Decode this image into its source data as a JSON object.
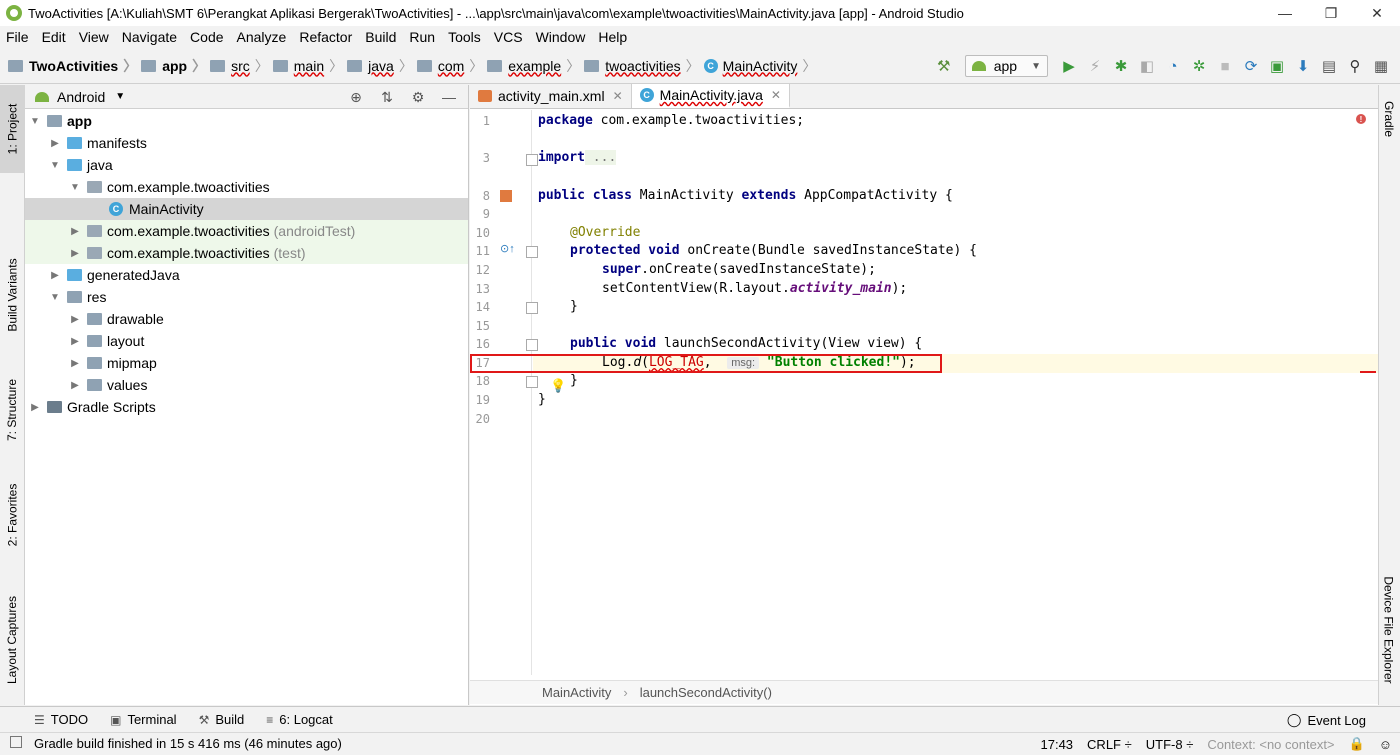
{
  "window": {
    "title": "TwoActivities [A:\\Kuliah\\SMT 6\\Perangkat Aplikasi Bergerak\\TwoActivities] - ...\\app\\src\\main\\java\\com\\example\\twoactivities\\MainActivity.java [app] - Android Studio",
    "minimize": "—",
    "maximize": "❐",
    "close": "✕"
  },
  "menu": [
    "File",
    "Edit",
    "View",
    "Navigate",
    "Code",
    "Analyze",
    "Refactor",
    "Build",
    "Run",
    "Tools",
    "VCS",
    "Window",
    "Help"
  ],
  "nav": {
    "crumbs": [
      "TwoActivities",
      "app",
      "src",
      "main",
      "java",
      "com",
      "example",
      "twoactivities",
      "MainActivity"
    ],
    "run_config": "app"
  },
  "left_tabs": [
    "1: Project",
    "Build Variants",
    "7: Structure",
    "2: Favorites",
    "Layout Captures"
  ],
  "right_tabs": [
    "Gradle",
    "Device File Explorer"
  ],
  "project": {
    "view": "Android",
    "tree": [
      {
        "label": "app",
        "suffix": ""
      },
      {
        "label": "manifests",
        "suffix": ""
      },
      {
        "label": "java",
        "suffix": ""
      },
      {
        "label": "com.example.twoactivities",
        "suffix": ""
      },
      {
        "label": "MainActivity",
        "suffix": ""
      },
      {
        "label": "com.example.twoactivities",
        "suffix": "(androidTest)"
      },
      {
        "label": "com.example.twoactivities",
        "suffix": "(test)"
      },
      {
        "label": "generatedJava",
        "suffix": ""
      },
      {
        "label": "res",
        "suffix": ""
      },
      {
        "label": "drawable",
        "suffix": ""
      },
      {
        "label": "layout",
        "suffix": ""
      },
      {
        "label": "mipmap",
        "suffix": ""
      },
      {
        "label": "values",
        "suffix": ""
      },
      {
        "label": "Gradle Scripts",
        "suffix": ""
      }
    ]
  },
  "editor": {
    "tabs": [
      "activity_main.xml",
      "MainActivity.java"
    ],
    "line_numbers": [
      "1",
      "3",
      "8",
      "9",
      "10",
      "11",
      "12",
      "13",
      "14",
      "15",
      "16",
      "17",
      "18",
      "19",
      "20"
    ],
    "code": {
      "l1_kw": "package",
      "l1_rest": " com.example.twoactivities;",
      "l3_kw": "import",
      "l3_fold": " ...",
      "l8_kw1": "public class",
      "l8_mid": " MainActivity ",
      "l8_kw2": "extends",
      "l8_rest": " AppCompatActivity {",
      "l10_ann": "@Override",
      "l11_kw": "protected void",
      "l11_rest": " onCreate(Bundle savedInstanceState) {",
      "l12_kw": "super",
      "l12_rest": ".onCreate(savedInstanceState);",
      "l13_pre": "setContentView(R.layout.",
      "l13_field": "activity_main",
      "l13_post": ");",
      "l14": "}",
      "l16_kw": "public void",
      "l16_rest": " launchSecondActivity(View view) {",
      "l17_pre": "Log.",
      "l17_m": "d",
      "l17_paren": "(",
      "l17_const": "LOG_TAG",
      "l17_comma": ", ",
      "l17_hint": "msg:",
      "l17_str": "\"Button clicked!\"",
      "l17_end": ");",
      "l18": "}",
      "l19": "}"
    },
    "breadcrumb": [
      "MainActivity",
      "launchSecondActivity()"
    ]
  },
  "bottom_tabs": [
    "TODO",
    "Terminal",
    "Build",
    "6: Logcat"
  ],
  "event_log": "Event Log",
  "status": {
    "message": "Gradle build finished in 15 s 416 ms (46 minutes ago)",
    "position": "17:43",
    "line_sep": "CRLF ÷",
    "encoding": "UTF-8 ÷",
    "context": "Context: <no context>"
  }
}
